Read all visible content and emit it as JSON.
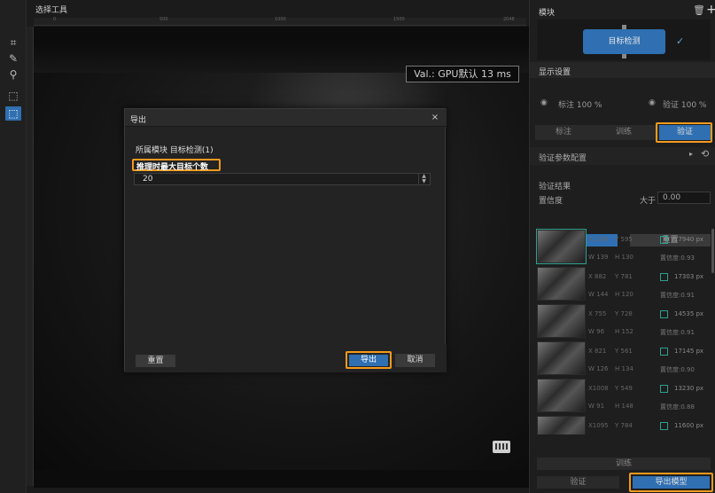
{
  "toolbar": {
    "title": "选择工具"
  },
  "ruler": {
    "ticks": [
      "0",
      "500",
      "1000",
      "1500",
      "2048"
    ]
  },
  "canvas": {
    "val_label": "Val.: GPU默认 13 ms"
  },
  "dialog": {
    "title": "导出",
    "close": "×",
    "module_line": "所属模块 目标检测(1)",
    "param_label": "推理时最大目标个数",
    "param_value": "20",
    "reset": "重置",
    "export": "导出",
    "cancel": "取消"
  },
  "panel": {
    "title": "模块",
    "node_label": "目标检测",
    "display_settings": "显示设置",
    "anno_percent": "标注 100 %",
    "verify_percent": "验证 100 %",
    "tabs": [
      "标注",
      "训练",
      "验证"
    ],
    "verify_param": "验证参数配置",
    "verify_result": "验证结果",
    "confidence": "置信度",
    "greater": "大于",
    "conf_value": "0.00",
    "apply": "应用",
    "reset": "重置",
    "results": [
      {
        "x": "X1148",
        "y": "Y 595",
        "w": "W 139",
        "h": "H 130",
        "px": "17940 px",
        "conf": "置信度:0.93"
      },
      {
        "x": "X 882",
        "y": "Y 781",
        "w": "W 144",
        "h": "H 120",
        "px": "17303 px",
        "conf": "置信度:0.91"
      },
      {
        "x": "X 755",
        "y": "Y 728",
        "w": "W 96",
        "h": "H 152",
        "px": "14535 px",
        "conf": "置信度:0.91"
      },
      {
        "x": "X 821",
        "y": "Y 561",
        "w": "W 126",
        "h": "H 134",
        "px": "17145 px",
        "conf": "置信度:0.90"
      },
      {
        "x": "X1008",
        "y": "Y 549",
        "w": "W 91",
        "h": "H 148",
        "px": "13230 px",
        "conf": "置信度:0.88"
      },
      {
        "x": "X1095",
        "y": "Y 784",
        "w": "",
        "h": "",
        "px": "11600 px",
        "conf": ""
      }
    ],
    "train": "训练",
    "verify": "验证",
    "export_model": "导出模型"
  },
  "colors": {
    "accent": "#2f6fb2",
    "highlight": "#f39a1e",
    "check": "#2f9e8c"
  }
}
